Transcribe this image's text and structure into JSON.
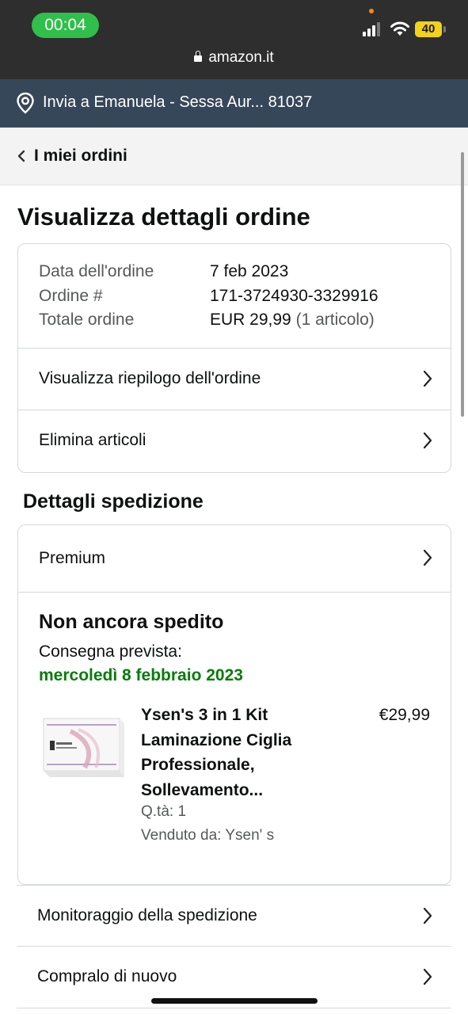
{
  "status_bar": {
    "time": "00:04",
    "battery": "40",
    "url": "amazon.it"
  },
  "delivery_bar": {
    "text": "Invia a Emanuela - Sessa Aur... 81037"
  },
  "breadcrumb": {
    "label": "I miei ordini"
  },
  "page": {
    "title": "Visualizza dettagli ordine"
  },
  "order_summary": {
    "rows": [
      {
        "label": "Data dell'ordine",
        "value": "7 feb 2023"
      },
      {
        "label": "Ordine #",
        "value": "171-3724930-3329916"
      },
      {
        "label": "Totale ordine",
        "value": "EUR 29,99",
        "note": "(1 articolo)"
      }
    ],
    "links": [
      {
        "label": "Visualizza riepilogo dell'ordine"
      },
      {
        "label": "Elimina articoli"
      }
    ]
  },
  "shipping": {
    "section_title": "Dettagli spedizione",
    "method": "Premium",
    "status": "Non ancora spedito",
    "eta_label": "Consegna prevista:",
    "eta_date": "mercoledì 8 febbraio 2023",
    "product": {
      "title_line1": "Ysen's 3 in 1 Kit",
      "title_line2": "Laminazione Ciglia",
      "title_line3": "Professionale,",
      "title_line4": "Sollevamento...",
      "price": "€29,99",
      "qty": "Q.tà: 1",
      "seller": "Venduto da: Ysen' s",
      "image_icon": "product-box-image"
    }
  },
  "actions": [
    {
      "label": "Monitoraggio della spedizione"
    },
    {
      "label": "Compralo di nuovo"
    }
  ],
  "colors": {
    "status_bar_bg": "#2e2e2e",
    "time_pill": "#2fbf4a",
    "battery": "#f2d21b",
    "delivery_bar_bg": "#37475a",
    "eta_green": "#067d0a",
    "border": "#d5d9d9"
  }
}
